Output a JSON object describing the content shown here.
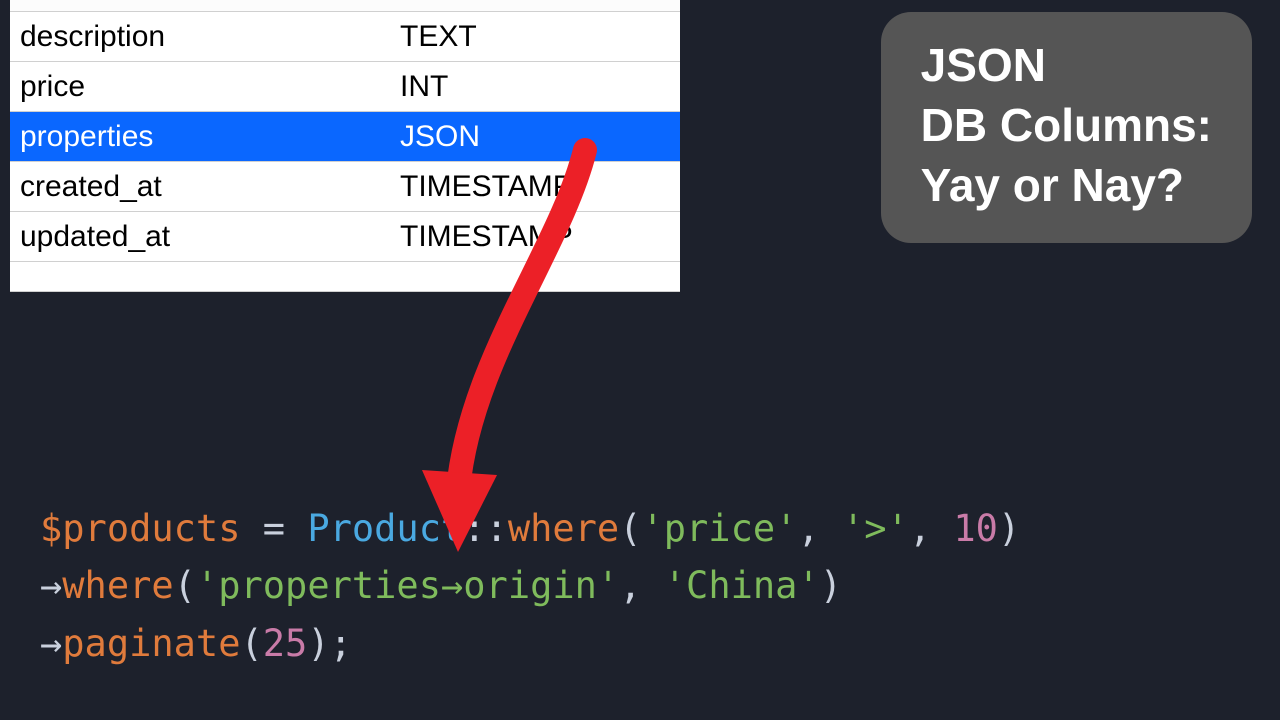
{
  "schema": {
    "rows": [
      {
        "name": "description",
        "type": "TEXT",
        "selected": false
      },
      {
        "name": "price",
        "type": "INT",
        "selected": false
      },
      {
        "name": "properties",
        "type": "JSON",
        "selected": true
      },
      {
        "name": "created_at",
        "type": "TIMESTAMP",
        "selected": false
      },
      {
        "name": "updated_at",
        "type": "TIMESTAMP",
        "selected": false
      }
    ]
  },
  "title_card": {
    "line1": "JSON",
    "line2": "DB Columns:",
    "line3": "Yay or Nay?"
  },
  "code": {
    "line1": {
      "var": "$products",
      "eq": " = ",
      "class": "Product",
      "scope": "::",
      "method": "where",
      "open": "(",
      "arg1": "'price'",
      "comma1": ", ",
      "arg2": "'>'",
      "comma2": ", ",
      "arg3": "10",
      "close": ")"
    },
    "line2": {
      "indent": "    ",
      "arrow": "→",
      "method": "where",
      "open": "(",
      "arg1": "'properties→origin'",
      "comma1": ", ",
      "arg2": "'China'",
      "close": ")"
    },
    "line3": {
      "indent": "    ",
      "arrow": "→",
      "method": "paginate",
      "open": "(",
      "arg1": "25",
      "close": ");"
    }
  },
  "colors": {
    "page_bg": "#1d212c",
    "row_selected": "#0a67ff",
    "card_bg": "#555555",
    "arrow": "#ec2027",
    "code_var": "#e07b3c",
    "code_class": "#4aa9e1",
    "code_string": "#7fbb5c",
    "code_number": "#c97ba8",
    "code_punct": "#c9d0dd"
  }
}
